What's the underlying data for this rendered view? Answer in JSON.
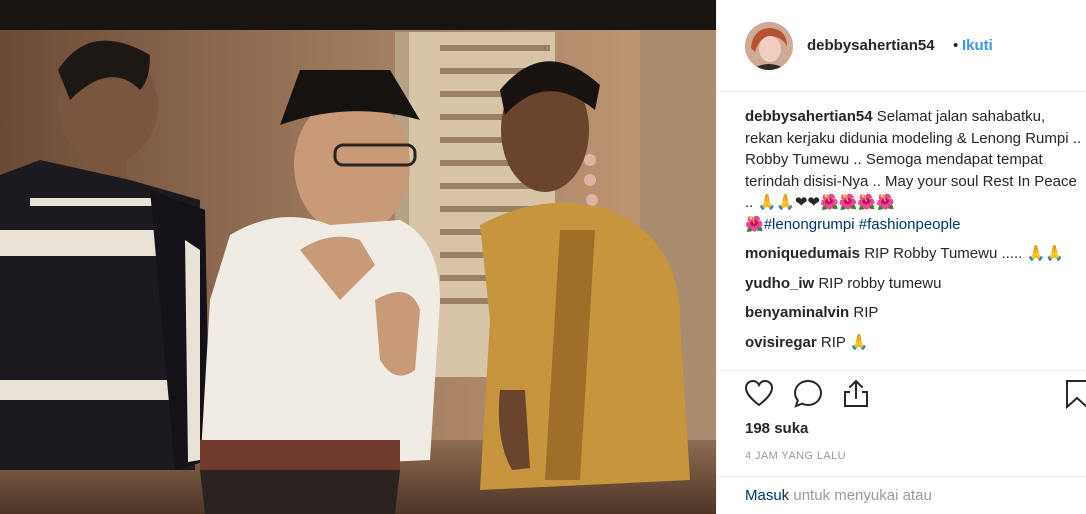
{
  "post": {
    "username": "debbysahertian54",
    "separator": "•",
    "follow_label": "Ikuti",
    "caption": {
      "username": "debbysahertian54",
      "text": "Selamat jalan sahabatku, rekan kerjaku didunia modeling & Lenong Rumpi .. Robby Tumewu .. Semoga mendapat tempat terindah disisi-Nya .. May your soul Rest In Peace .. 🙏🙏❤❤🌺🌺🌺🌺",
      "line_start": "🌺",
      "hashtags": [
        "#lenongrumpi",
        "#fashionpeople"
      ]
    },
    "comments": [
      {
        "username": "moniquedumais",
        "text": "RIP Robby Tumewu ..... 🙏🙏"
      },
      {
        "username": "yudho_iw",
        "text": "RIP robby tumewu"
      },
      {
        "username": "benyaminalvin",
        "text": "RIP"
      },
      {
        "username": "ovisiregar",
        "text": "RIP 🙏"
      }
    ],
    "likes": "198 suka",
    "time_ago": "4 JAM YANG LALU",
    "login_link": "Masuk",
    "login_text": "untuk menyukai atau",
    "icons": [
      "heart-icon",
      "comment-icon",
      "share-icon",
      "bookmark-icon"
    ]
  },
  "colors": {
    "link_blue": "#3897f0",
    "hashtag_dark": "#003569",
    "meta_gray": "#999999"
  }
}
